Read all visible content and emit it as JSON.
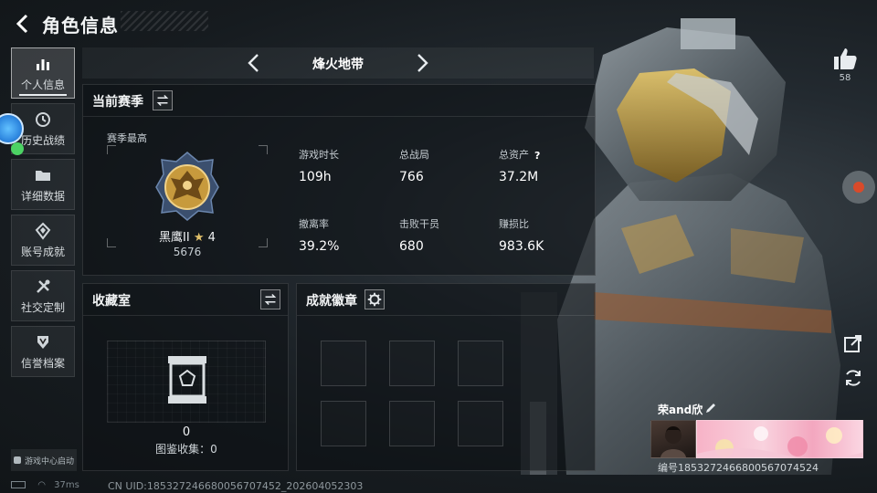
{
  "header": {
    "title": "角色信息"
  },
  "sidebar": {
    "items": [
      {
        "label": "个人信息",
        "icon": "bar-chart-icon",
        "active": true
      },
      {
        "label": "历史战绩",
        "icon": "clock-icon"
      },
      {
        "label": "详细数据",
        "icon": "folder-icon"
      },
      {
        "label": "账号成就",
        "icon": "medal-icon"
      },
      {
        "label": "社交定制",
        "icon": "tools-icon"
      },
      {
        "label": "信誉档案",
        "icon": "shield-icon"
      }
    ],
    "launch_label": "游戏中心启动"
  },
  "map_selector": {
    "name": "烽火地带"
  },
  "season": {
    "title": "当前赛季",
    "best_label": "赛季最高",
    "rank_name": "黑鹰II",
    "rank_stars": "4",
    "rank_score": "5676",
    "stats": [
      {
        "label": "游戏时长",
        "value": "109h"
      },
      {
        "label": "总战局",
        "value": "766"
      },
      {
        "label": "总资产",
        "value": "37.2M",
        "help": "?"
      },
      {
        "label": "撤离率",
        "value": "39.2%"
      },
      {
        "label": "击败干员",
        "value": "680"
      },
      {
        "label": "赚损比",
        "value": "983.6K"
      }
    ]
  },
  "collection": {
    "title": "收藏室",
    "count": "0",
    "label": "图鉴收集：0"
  },
  "badges": {
    "title": "成就徽章"
  },
  "likes": {
    "count": "58"
  },
  "profile_card": {
    "player_name": "荣and欣",
    "id_text": "编号1853272466800567074524"
  },
  "status": {
    "ping": "37ms",
    "uid_line": "CN UID:185327246680056707452_202604052303"
  },
  "colors": {
    "accent": "#e8ecef",
    "panel_bg": "#0c1014",
    "banner_pink": "#f7b3c7",
    "online_green": "#4cd264"
  }
}
